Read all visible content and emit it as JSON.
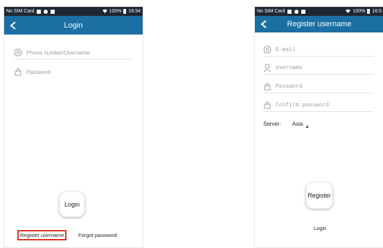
{
  "login_screen": {
    "status": {
      "carrier": "No SIM Card",
      "battery": "100%",
      "time": "16:54"
    },
    "title": "Login",
    "phone_placeholder": "Phone number/Username",
    "password_placeholder": "Password",
    "login_button": "Login",
    "register_link": "Register username",
    "forgot_link": "Forgot password"
  },
  "register_screen": {
    "status": {
      "carrier": "No SIM Card",
      "battery": "100%",
      "time": "16:5"
    },
    "title": "Register username",
    "email_placeholder": "E-mail",
    "username_placeholder": "Username",
    "password_placeholder": "Password",
    "confirm_placeholder": "Confirm password",
    "server_label": "Server:",
    "server_value": "Asia",
    "register_button": "Register",
    "login_link": "Login"
  },
  "colors": {
    "appbar": "#1b6fa3",
    "statusbar": "#1e2733",
    "highlight": "#d9311e"
  },
  "icons": [
    "back-arrow-icon",
    "at-icon",
    "user-icon",
    "lock-icon",
    "wifi-icon",
    "battery-icon"
  ]
}
